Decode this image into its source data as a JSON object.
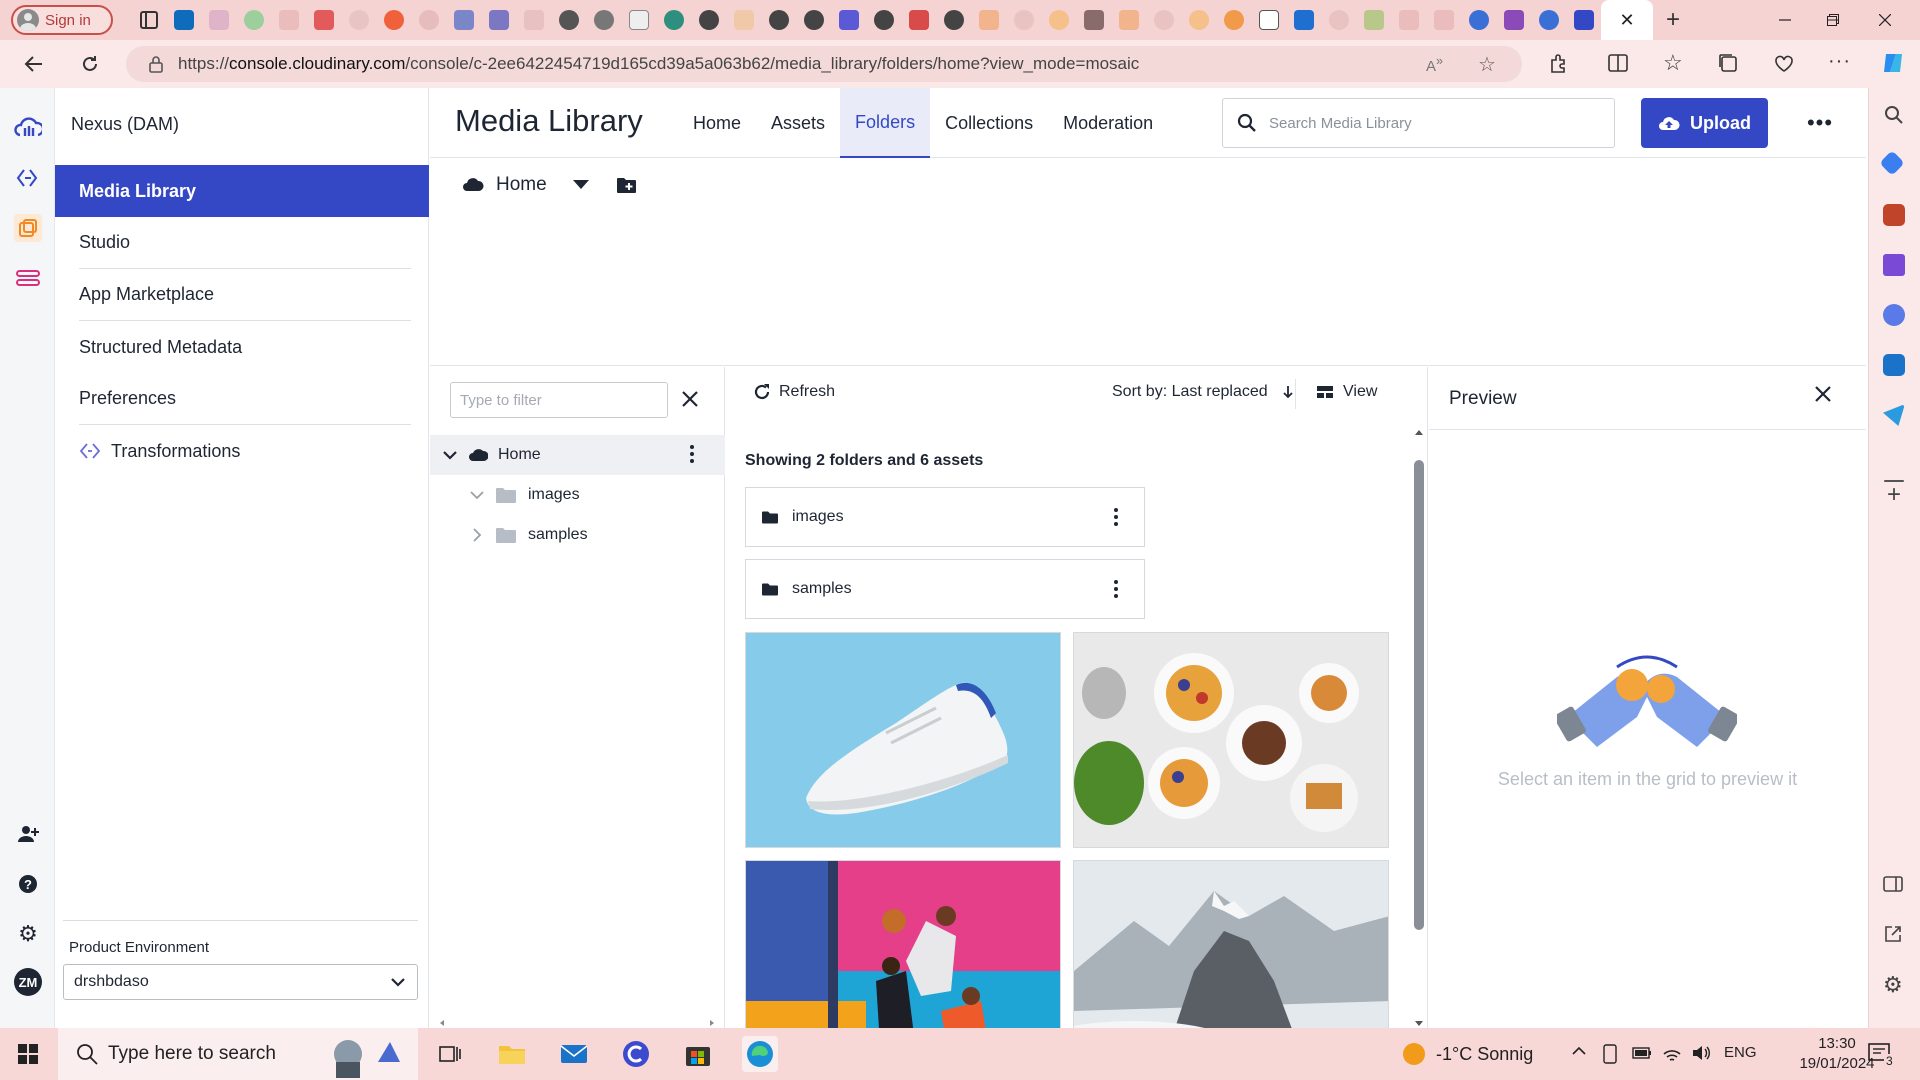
{
  "browser": {
    "signin_label": "Sign in",
    "url_prefix": "https://",
    "url_host": "console.cloudinary.com",
    "url_path": "/console/c-2ee6422454719d165cd39a5a063b62/media_library/folders/home?view_mode=mosaic"
  },
  "leftnav": {
    "env_title": "Nexus (DAM)",
    "items": [
      {
        "label": "Media Library"
      },
      {
        "label": "Studio"
      },
      {
        "label": "App Marketplace"
      },
      {
        "label": "Structured Metadata"
      },
      {
        "label": "Preferences"
      },
      {
        "label": "Transformations"
      }
    ],
    "product_env_label": "Product Environment",
    "product_env_value": "drshbdaso",
    "avatar_initials": "ZM"
  },
  "header": {
    "title": "Media Library",
    "tabs": [
      {
        "label": "Home"
      },
      {
        "label": "Assets"
      },
      {
        "label": "Folders"
      },
      {
        "label": "Collections"
      },
      {
        "label": "Moderation"
      }
    ],
    "active_tab": "Folders",
    "search_placeholder": "Search Media Library",
    "upload_label": "Upload"
  },
  "breadcrumb": {
    "current": "Home"
  },
  "tree": {
    "filter_placeholder": "Type to filter",
    "root": "Home",
    "children": [
      {
        "label": "images"
      },
      {
        "label": "samples"
      }
    ]
  },
  "toolbar": {
    "refresh_label": "Refresh",
    "sort_label": "Sort by: Last replaced",
    "view_label": "View"
  },
  "grid": {
    "summary": "Showing 2 folders and 6 assets",
    "folders": [
      {
        "label": "images"
      },
      {
        "label": "samples"
      }
    ]
  },
  "preview": {
    "title": "Preview",
    "empty_message": "Select an item in the grid to preview it"
  },
  "taskbar": {
    "search_placeholder": "Type here to search",
    "weather": "-1°C  Sonnig",
    "language": "ENG",
    "time": "13:30",
    "date": "19/01/2024",
    "notification_count": "3"
  },
  "colors": {
    "brand": "#3448c5",
    "chrome": "#f6d3d3"
  }
}
